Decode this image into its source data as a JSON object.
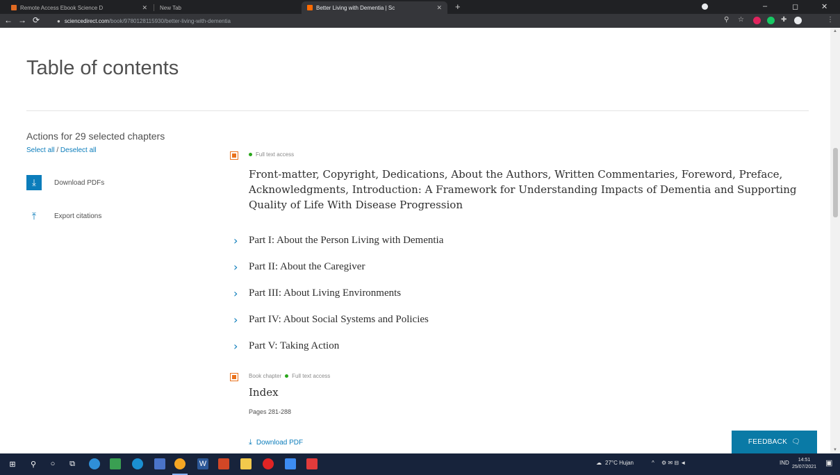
{
  "browser": {
    "tabs": [
      {
        "label": "Remote Access Ebook Science D",
        "active": false
      },
      {
        "label": "New Tab",
        "active": false
      },
      {
        "label": "Better Living with Dementia | Sc",
        "active": true
      }
    ],
    "url_host": "sciencedirect.com",
    "url_path": "/book/9780128115930/better-living-with-dementia",
    "icons": {
      "back": "←",
      "forward": "→",
      "reload": "⟳",
      "lock": "🔒",
      "new_tab": "+",
      "close": "✕",
      "minimize": "–",
      "maximize": "◻",
      "search_ext": "⚲",
      "star": "☆",
      "puzzle": "✚"
    }
  },
  "page": {
    "title": "Table of contents",
    "sidebar": {
      "heading": "Actions for 29 selected chapters",
      "select_all": "Select all",
      "separator": "/",
      "deselect_all": "Deselect all",
      "download_pdfs": "Download PDFs",
      "export_citations": "Export citations",
      "download_icon": "⤓",
      "export_icon": "⤒"
    },
    "chapters": [
      {
        "type_label": "",
        "access": "Full text access",
        "title": "Front-matter, Copyright, Dedications, About the Authors, Written Commentaries, Foreword, Preface, Acknowledgments, Introduction: A Framework for Understanding Impacts of Dementia and Supporting Quality of Life With Disease Progression"
      }
    ],
    "parts": [
      "Part I: About the Person Living with Dementia",
      "Part II: About the Caregiver",
      "Part III: About Living Environments",
      "Part IV: About Social Systems and Policies",
      "Part V: Taking Action"
    ],
    "index_chapter": {
      "type_label": "Book chapter",
      "access": "Full text access",
      "title": "Index",
      "pages": "Pages 281-288",
      "download": "Download PDF"
    },
    "chevron": "›",
    "feedback": "FEEDBACK",
    "feedback_icon": "🗨"
  },
  "taskbar": {
    "weather": "27°C Hujan",
    "language": "IND",
    "time": "14:51",
    "date": "25/07/2021",
    "start_icon": "⊞",
    "search_icon": "⚲",
    "cortana_icon": "○",
    "taskview_icon": "⧉"
  },
  "colors": {
    "accent": "#0c7dbb",
    "checkbox": "#e9711c",
    "access_dot": "#29a61b",
    "feedback_bg": "#0a7aa6"
  }
}
